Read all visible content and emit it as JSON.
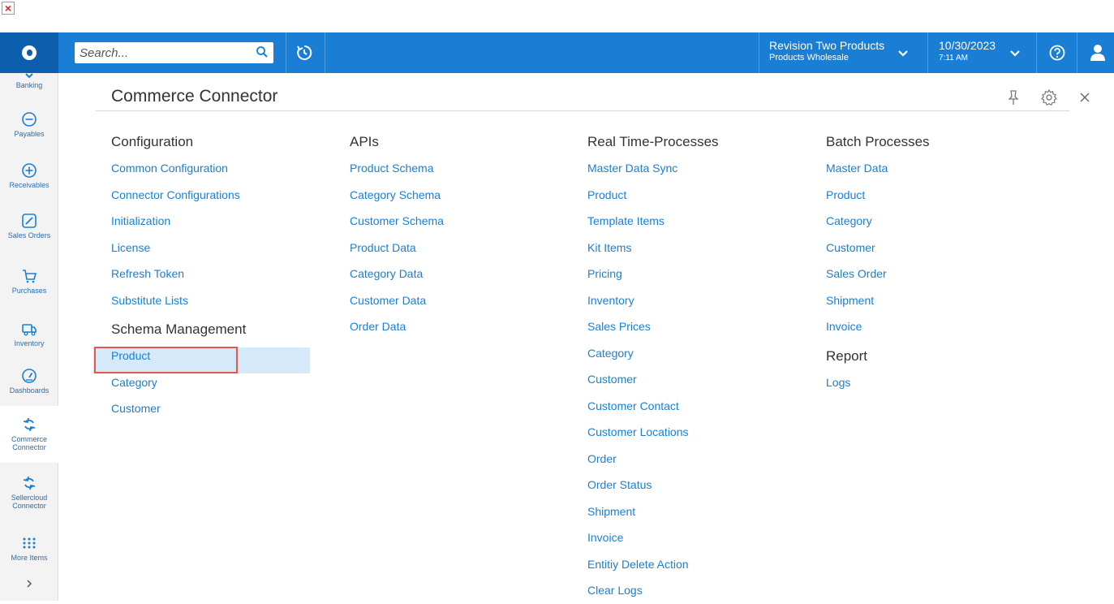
{
  "topbar": {
    "search_placeholder": "Search...",
    "tenant_name": "Revision Two Products",
    "tenant_branch": "Products Wholesale",
    "date": "10/30/2023",
    "time": "7:11 AM"
  },
  "sidebar": {
    "items": [
      {
        "label": "Banking",
        "icon": "banking-icon"
      },
      {
        "label": "Payables",
        "icon": "minus-circle-icon"
      },
      {
        "label": "Receivables",
        "icon": "plus-circle-icon"
      },
      {
        "label": "Sales Orders",
        "icon": "pencil-icon"
      },
      {
        "label": "Purchases",
        "icon": "cart-icon"
      },
      {
        "label": "Inventory",
        "icon": "truck-icon"
      },
      {
        "label": "Dashboards",
        "icon": "gauge-icon"
      },
      {
        "label": "Commerce Connector",
        "icon": "sync-icon"
      },
      {
        "label": "Sellercloud Connector",
        "icon": "sync-icon"
      },
      {
        "label": "More Items",
        "icon": "grid-dots-icon"
      }
    ]
  },
  "page": {
    "title": "Commerce Connector"
  },
  "columns": {
    "configuration": {
      "heading": "Configuration",
      "links": [
        "Common Configuration",
        "Connector Configurations",
        "Initialization",
        "License",
        "Refresh Token",
        "Substitute Lists"
      ],
      "sub_heading": "Schema Management",
      "sub_links": [
        "Product",
        "Category",
        "Customer"
      ]
    },
    "apis": {
      "heading": "APIs",
      "links": [
        "Product Schema",
        "Category Schema",
        "Customer Schema",
        "Product Data",
        "Category Data",
        "Customer Data",
        "Order Data"
      ]
    },
    "realtime": {
      "heading": "Real Time-Processes",
      "links": [
        "Master Data Sync",
        "Product",
        "Template Items",
        "Kit Items",
        "Pricing",
        "Inventory",
        "Sales Prices",
        "Category",
        "Customer",
        "Customer Contact",
        "Customer Locations",
        "Order",
        "Order Status",
        "Shipment",
        "Invoice",
        "Entitiy Delete Action",
        "Clear Logs"
      ]
    },
    "batch": {
      "heading": "Batch Processes",
      "links": [
        "Master Data",
        "Product",
        "Category",
        "Customer",
        "Sales Order",
        "Shipment",
        "Invoice"
      ],
      "sub_heading": "Report",
      "sub_links": [
        "Logs"
      ]
    }
  },
  "colors": {
    "topbar": "#1a7fd4",
    "logo_bg": "#0d5fae",
    "link": "#1a7fd4",
    "highlight": "#d5e9f8",
    "callout": "#e0584e"
  }
}
